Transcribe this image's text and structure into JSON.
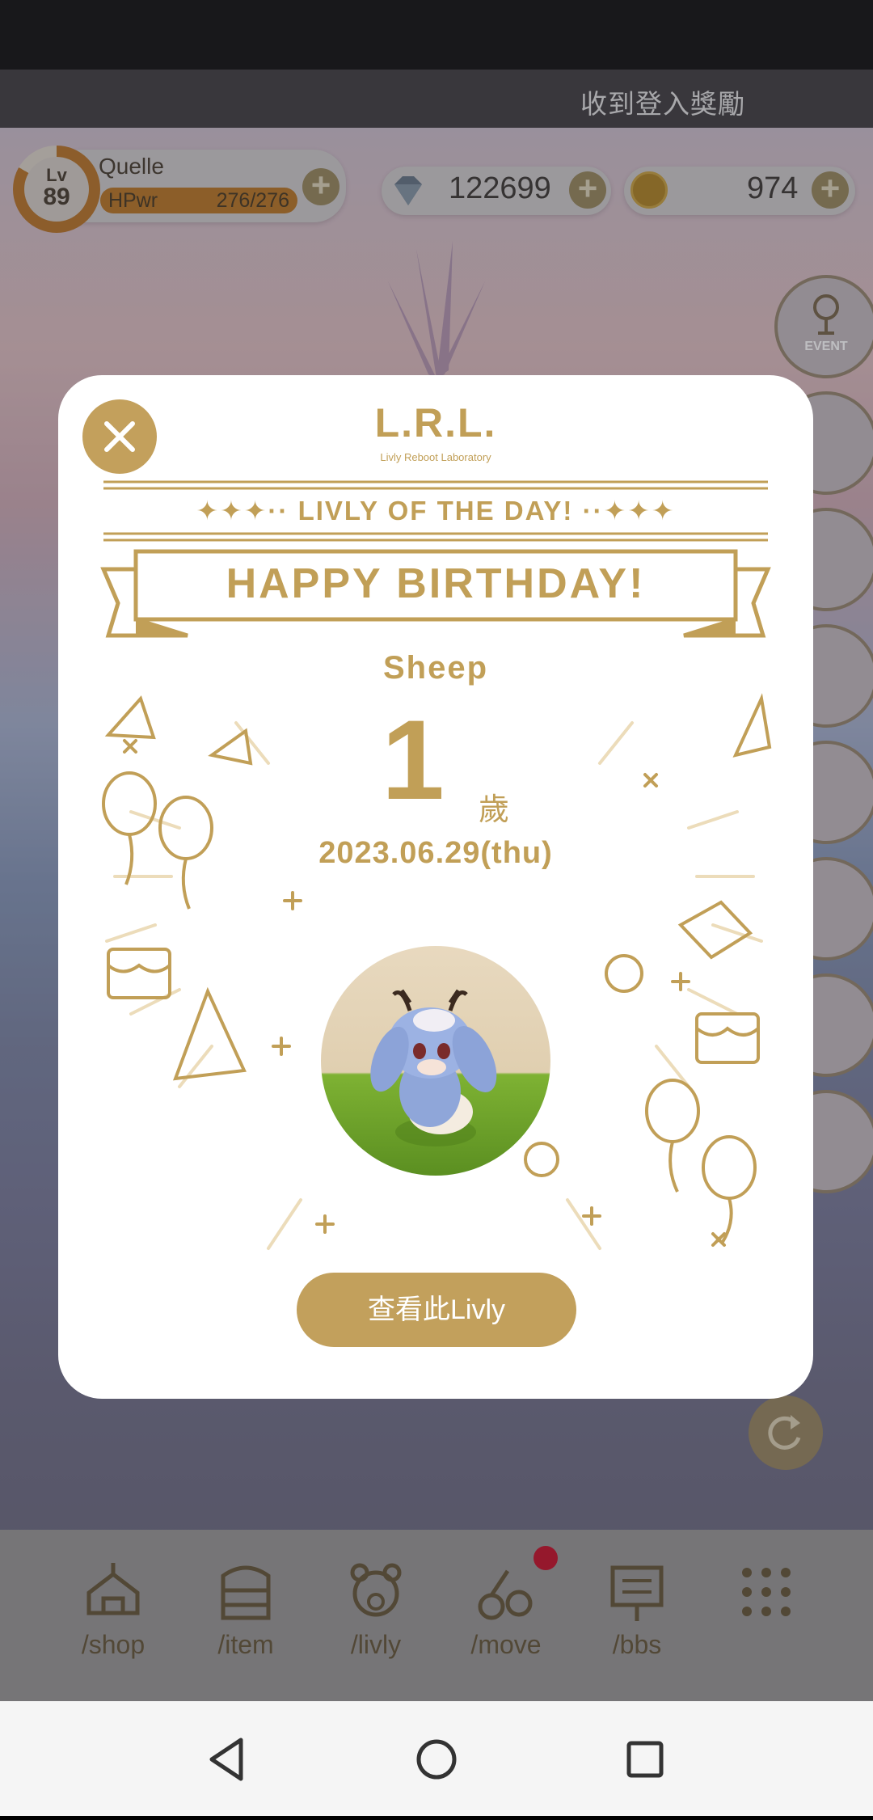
{
  "app": {
    "notification_title": "收到登入獎勵"
  },
  "player": {
    "level_label": "Lv",
    "level": "89",
    "name": "Quelle",
    "hp_label": "HPwr",
    "hp_value": "276/276",
    "hp_fraction": 1.0
  },
  "currency": {
    "gems": "122699",
    "coins": "974"
  },
  "side_buttons": {
    "event_label": "EVENT"
  },
  "modal": {
    "logo": "L.R.L.",
    "logo_sub": "Livly Reboot Laboratory",
    "livly_of_day": "LIVLY OF THE DAY!",
    "banner": "HAPPY BIRTHDAY!",
    "name": "Sheep",
    "age_number": "1",
    "age_unit": "歲",
    "date": "2023.06.29(thu)",
    "view_button": "查看此Livly"
  },
  "bottom_nav": {
    "items": [
      {
        "label": "/shop",
        "icon": "tent-icon"
      },
      {
        "label": "/item",
        "icon": "drawer-icon"
      },
      {
        "label": "/livly",
        "icon": "bear-face-icon"
      },
      {
        "label": "/move",
        "icon": "paw-move-icon"
      },
      {
        "label": "/bbs",
        "icon": "board-icon"
      },
      {
        "label": "",
        "icon": "grid-menu-icon"
      }
    ]
  },
  "colors": {
    "gold": "#c19f57",
    "modal_bg": "#ffffff",
    "notification_dot": "#c0001b"
  }
}
